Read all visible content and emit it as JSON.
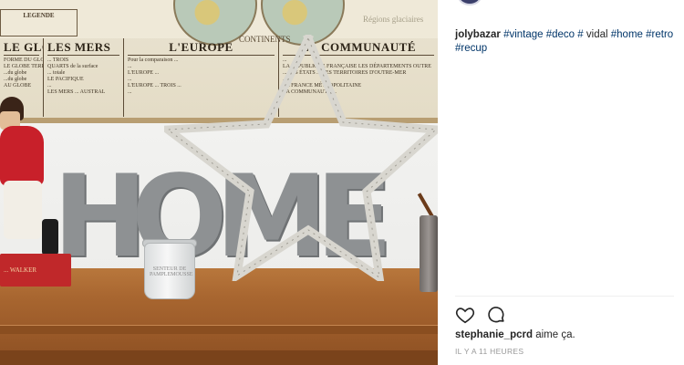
{
  "photo": {
    "map": {
      "legend_title": "LEGENDE",
      "continents_label": "CONTINENTS",
      "regions_label": "Régions glaciaires",
      "columns": [
        {
          "title": "LE GLOBE",
          "lines": [
            "FORME DU GLOBE",
            "LE GLOBE TERRESTRE",
            "...du globe",
            "...du globe",
            "AU GLOBE"
          ]
        },
        {
          "title": "LES MERS",
          "lines": [
            "... TROIS",
            "QUARTS de la surface",
            "... totale",
            "LE PACIFIQUE",
            "...",
            "LES MERS ... AUSTRAL"
          ]
        },
        {
          "title": "L'EUROPE",
          "lines": [
            "Pour la comparaison ...",
            "...",
            "L'EUROPE ...",
            "...",
            "L'EUROPE ... TROIS ...",
            "..."
          ]
        },
        {
          "title": "LA COMMUNAUTÉ",
          "lines": [
            "...",
            "LA RÉPUBLIQUE FRANÇAISE LES DÉPARTEMENTS OUTRE",
            "... LES ÉTATS ... LES TERRITOIRES D'OUTRE-MER",
            "...",
            "LA FRANCE MÉTROPOLITAINE",
            "LA COMMUNAUTÉ ..."
          ]
        }
      ]
    },
    "letters": [
      "H",
      "O",
      "M",
      "E"
    ],
    "jar_label": "SENTEUR DE PAMPLEMOUSSE",
    "figure_base_label": "... WALKER"
  },
  "post": {
    "username": "jolybazar",
    "caption_tags": [
      "#vintage",
      "#deco",
      "#",
      "#home",
      "#retro",
      "#recup"
    ],
    "caption_plain_after_tag3": "vidal",
    "liked_by": "stephanie_pcrd",
    "likes_suffix": "aime ça.",
    "timestamp": "IL Y A 11 HEURES"
  },
  "icons": {
    "like": "heart-icon",
    "comment": "comment-icon"
  }
}
